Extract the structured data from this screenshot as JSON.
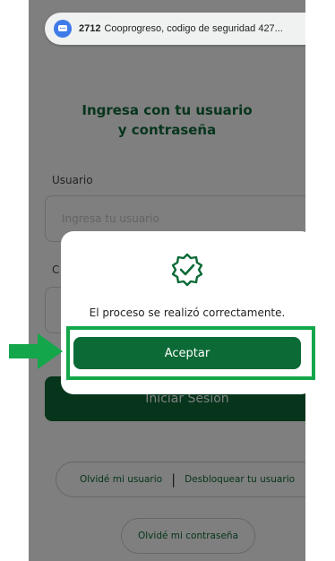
{
  "notification": {
    "number": "2712",
    "text": "Cooprogreso, codigo de seguridad 427..."
  },
  "login": {
    "heading_line1": "Ingresa con tu usuario",
    "heading_line2": "y contraseña",
    "user_label": "Usuario",
    "user_placeholder": "Ingresa tu usuario",
    "password_label": "C",
    "submit_label": "Iniciar Sesión",
    "forgot_user": "Olvidé mi usuario",
    "separator": "|",
    "unlock_user": "Desbloquear tu usuario",
    "forgot_password": "Olvidé mi contraseña"
  },
  "modal": {
    "message": "El proceso se realizó correctamente.",
    "accept_label": "Aceptar"
  },
  "colors": {
    "brand_green": "#0c6a36",
    "highlight_green": "#14a64a"
  }
}
